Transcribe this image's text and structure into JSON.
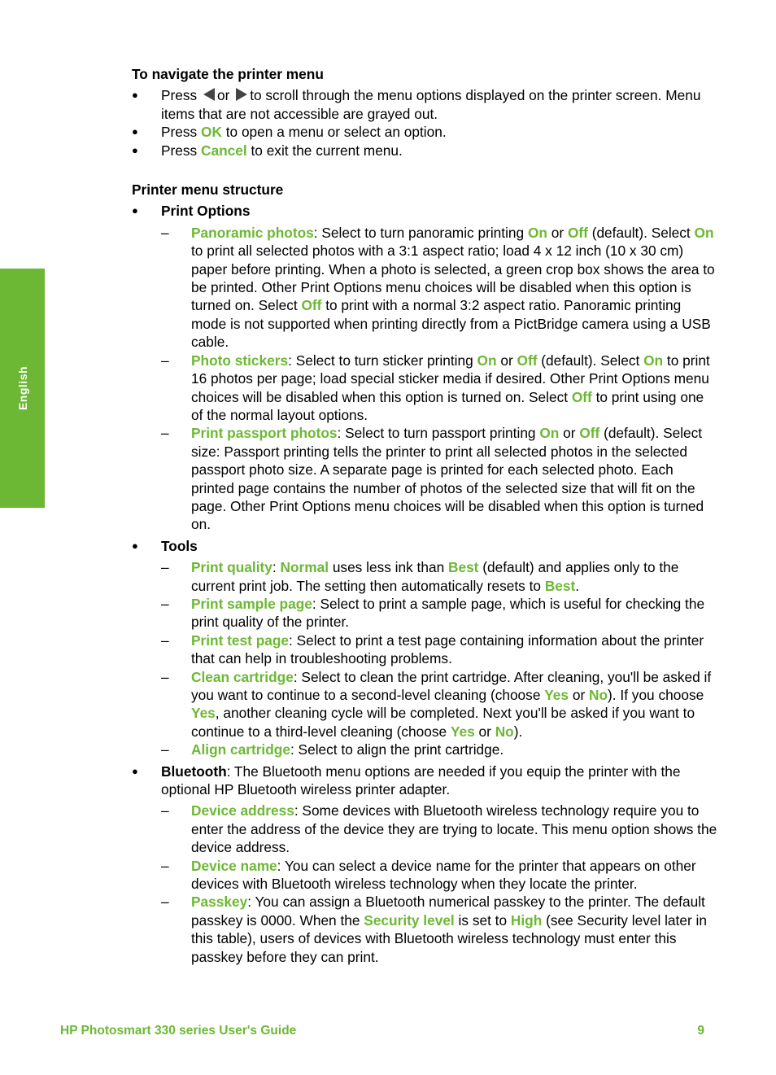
{
  "side_tab": {
    "label": "English"
  },
  "navigate": {
    "heading": "To navigate the printer menu",
    "item1": {
      "pre": "Press",
      "or": "or",
      "post": "to scroll through the menu options displayed on the printer screen. Menu items that are not accessible are grayed out."
    },
    "item2": {
      "pre": "Press",
      "key": "OK",
      "post": "to open a menu or select an option."
    },
    "item3": {
      "pre": "Press",
      "key": "Cancel",
      "post": "to exit the current menu."
    }
  },
  "structure": {
    "heading": "Printer menu structure",
    "print_options": {
      "title": "Print Options",
      "panoramic": {
        "name": "Panoramic photos",
        "t1": ": Select to turn panoramic printing ",
        "on": "On",
        "or": " or ",
        "off": "Off",
        "t2": " (default). Select ",
        "on2": "On",
        "t3": " to print all selected photos with a 3:1 aspect ratio; load 4 x 12 inch (10 x 30 cm) paper before printing. When a photo is selected, a green crop box shows the area to be printed. Other Print Options menu choices will be disabled when this option is turned on. Select ",
        "off2": "Off",
        "t4": " to print with a normal 3:2 aspect ratio. Panoramic printing mode is not supported when printing directly from a PictBridge camera using a USB cable."
      },
      "stickers": {
        "name": "Photo stickers",
        "t1": ": Select to turn sticker printing ",
        "on": "On",
        "or": " or ",
        "off": "Off",
        "t2": " (default). Select ",
        "on2": "On",
        "t3": " to print 16 photos per page; load special sticker media if desired. Other Print Options menu choices will be disabled when this option is turned on. Select ",
        "off2": "Off",
        "t4": " to print using one of the normal layout options."
      },
      "passport": {
        "name": "Print passport photos",
        "t1": ": Select to turn passport printing ",
        "on": "On",
        "or": " or ",
        "off": "Off",
        "t2": " (default). Select size: Passport printing tells the printer to print all selected photos in the selected passport photo size. A separate page is printed for each selected photo. Each printed page contains the number of photos of the selected size that will fit on the page. Other Print Options menu choices will be disabled when this option is turned on."
      }
    },
    "tools": {
      "title": "Tools",
      "quality": {
        "name": "Print quality",
        "t1": ": ",
        "normal": "Normal",
        "t2": " uses less ink than ",
        "best": "Best",
        "t3": " (default) and applies only to the current print job. The setting then automatically resets to ",
        "best2": "Best",
        "t4": "."
      },
      "sample": {
        "name": "Print sample page",
        "t1": ": Select to print a sample page, which is useful for checking the print quality of the printer."
      },
      "test": {
        "name": "Print test page",
        "t1": ": Select to print a test page containing information about the printer that can help in troubleshooting problems."
      },
      "clean": {
        "name": "Clean cartridge",
        "t1": ": Select to clean the print cartridge. After cleaning, you'll be asked if you want to continue to a second-level cleaning (choose ",
        "yes": "Yes",
        "or": " or ",
        "no": "No",
        "t2": "). If you choose ",
        "yes2": "Yes",
        "t3": ", another cleaning cycle will be completed. Next you'll be asked if you want to continue to a third-level cleaning (choose ",
        "yes3": "Yes",
        "or2": " or ",
        "no2": "No",
        "t4": ")."
      },
      "align": {
        "name": "Align cartridge",
        "t1": ": Select to align the print cartridge."
      }
    },
    "bluetooth": {
      "title": "Bluetooth",
      "desc": ": The Bluetooth menu options are needed if you equip the printer with the optional HP Bluetooth wireless printer adapter.",
      "address": {
        "name": "Device address",
        "t1": ": Some devices with Bluetooth wireless technology require you to enter the address of the device they are trying to locate. This menu option shows the device address."
      },
      "devname": {
        "name": "Device name",
        "t1": ": You can select a device name for the printer that appears on other devices with Bluetooth wireless technology when they locate the printer."
      },
      "passkey": {
        "name": "Passkey",
        "t1": ": You can assign a Bluetooth numerical passkey to the printer. The default passkey is 0000. When the ",
        "security": "Security level",
        "t2": " is set to ",
        "high": "High",
        "t3": " (see Security level later in this table), users of devices with Bluetooth wireless technology must enter this passkey before they can print."
      }
    }
  },
  "footer": {
    "title": "HP Photosmart 330 series User's Guide",
    "page": "9"
  },
  "colors": {
    "accent": "#6cb834"
  }
}
